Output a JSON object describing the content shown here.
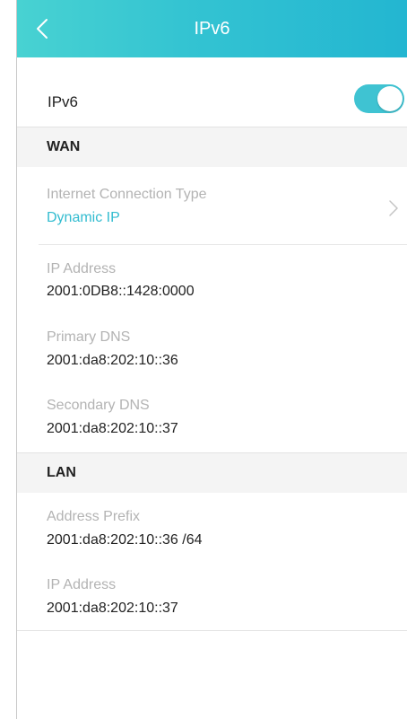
{
  "header": {
    "title": "IPv6",
    "back_icon": "chevron-left-icon"
  },
  "toggle": {
    "label": "IPv6",
    "enabled": true,
    "color": "#3fc3d2"
  },
  "wan": {
    "section_title": "WAN",
    "connection_type": {
      "label": "Internet Connection Type",
      "value": "Dynamic IP",
      "chevron_icon": "chevron-right-icon"
    },
    "ip_address": {
      "label": "IP Address",
      "value": "2001:0DB8::1428:0000"
    },
    "primary_dns": {
      "label": "Primary DNS",
      "value": "2001:da8:202:10::36"
    },
    "secondary_dns": {
      "label": "Secondary DNS",
      "value": "2001:da8:202:10::37"
    }
  },
  "lan": {
    "section_title": "LAN",
    "address_prefix": {
      "label": "Address Prefix",
      "value": "2001:da8:202:10::36 /64"
    },
    "ip_address": {
      "label": "IP Address",
      "value": "2001:da8:202:10::37"
    }
  },
  "colors": {
    "accent": "#32bcd0",
    "header_start": "#48d2d2",
    "header_end": "#23b6d1",
    "muted_label": "#b3b3b3"
  }
}
